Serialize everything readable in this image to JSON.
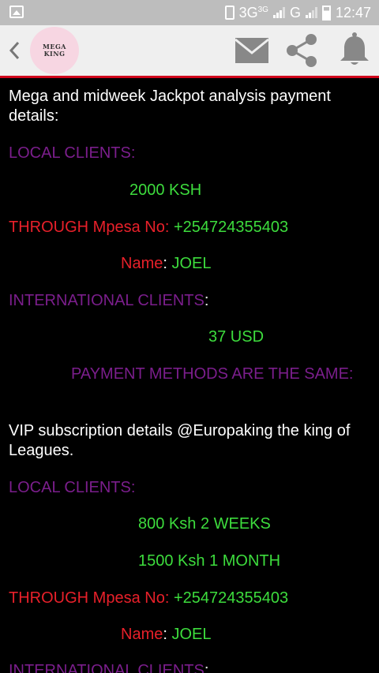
{
  "status_bar": {
    "network": "3G",
    "network_sup": "3G",
    "network2": "G",
    "time": "12:47"
  },
  "app_bar": {
    "logo_line1": "MEGA",
    "logo_line2": "KING"
  },
  "content": {
    "para1": "Mega and midweek Jackpot analysis payment details:",
    "local1_label": "LOCAL CLIENTS:",
    "local1_price": "2000 KSH",
    "through1_label": "THROUGH Mpesa No:",
    "through1_number": "+254724355403",
    "name1_label": "Name",
    "name1_colon": ":",
    "name1_value": "JOEL",
    "intl1_label": "INTERNATIONAL CLIENTS",
    "intl1_colon": ":",
    "intl1_price": "37 USD",
    "methods_same": "PAYMENT METHODS ARE THE SAME:",
    "para2": "VIP subscription details @Europaking the king of Leagues.",
    "local2_label": "LOCAL CLIENTS:",
    "local2_price1": "800 Ksh 2 WEEKS",
    "local2_price2": "1500 Ksh 1 MONTH",
    "through2_label": "THROUGH Mpesa No:",
    "through2_number": "+254724355403",
    "name2_label": "Name",
    "name2_colon": ":",
    "name2_value": "JOEL",
    "intl2_label": "INTERNATIONAL CLIENTS",
    "intl2_colon": ":"
  }
}
